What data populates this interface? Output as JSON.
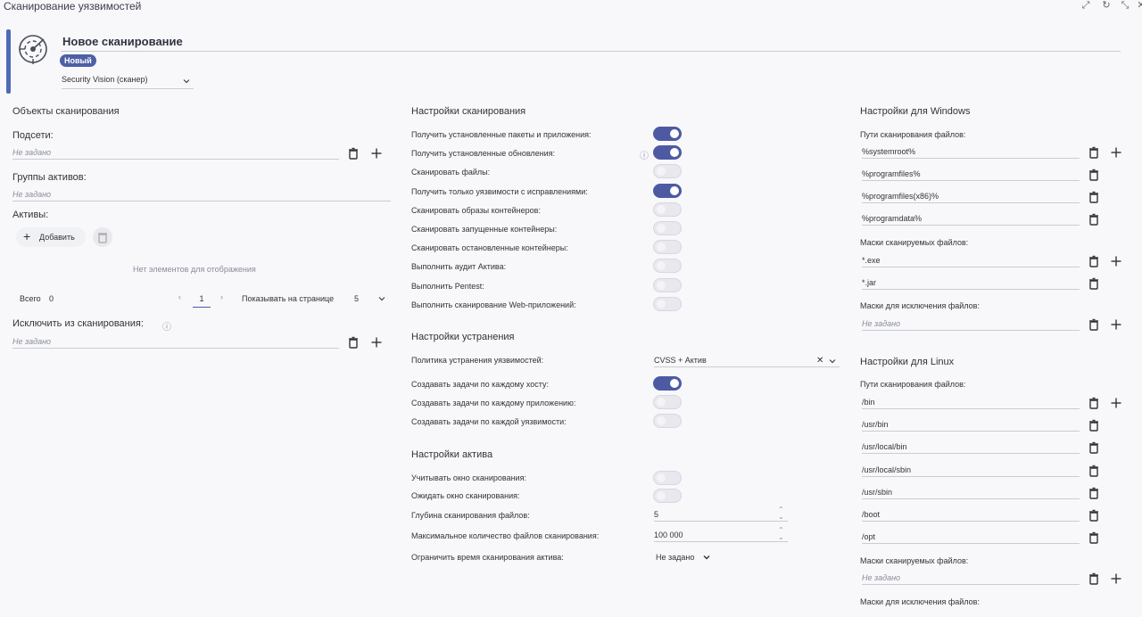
{
  "window": {
    "title": "Сканирование уязвимостей"
  },
  "header": {
    "title": "Новое сканирование",
    "badge": "Новый",
    "scanner": "Security Vision (сканер)"
  },
  "objects": {
    "title": "Объекты сканирования",
    "subnets_label": "Подсети:",
    "subnets_placeholder": "Не задано",
    "groups_label": "Группы активов:",
    "groups_placeholder": "Не задано",
    "assets_label": "Активы:",
    "add_label": "Добавить",
    "empty": "Нет элементов для отображения",
    "total_label": "Всего",
    "total_value": "0",
    "page": "1",
    "per_page_label": "Показывать на странице",
    "per_page_value": "5",
    "exclude_label": "Исключить из сканирования:",
    "exclude_placeholder": "Не задано"
  },
  "scan_settings": {
    "title": "Настройки сканирования",
    "items": [
      {
        "label": "Получить установленные пакеты и приложения:",
        "on": true
      },
      {
        "label": "Получить установленные обновления:",
        "on": true,
        "info": true
      },
      {
        "label": "Сканировать файлы:",
        "on": false
      },
      {
        "label": "Получить только уязвимости с исправлениями:",
        "on": true
      },
      {
        "label": "Сканировать образы контейнеров:",
        "on": false
      },
      {
        "label": "Сканировать запущенные контейнеры:",
        "on": false
      },
      {
        "label": "Сканировать остановленные контейнеры:",
        "on": false
      },
      {
        "label": "Выполнить аудит Актива:",
        "on": false
      },
      {
        "label": "Выполнить Pentest:",
        "on": false
      },
      {
        "label": "Выполнить сканирование Web-приложений:",
        "on": false
      }
    ]
  },
  "remediation": {
    "title": "Настройки устранения",
    "policy_label": "Политика устранения уязвимостей:",
    "policy_value": "CVSS + Актив",
    "items": [
      {
        "label": "Создавать задачи по каждому хосту:",
        "on": true
      },
      {
        "label": "Создавать задачи по каждому приложению:",
        "on": false
      },
      {
        "label": "Создавать задачи по каждой уязвимости:",
        "on": false
      }
    ]
  },
  "asset_settings": {
    "title": "Настройки актива",
    "window_label": "Учитывать окно сканирования:",
    "window_on": false,
    "wait_label": "Ожидать окно сканирования:",
    "wait_on": false,
    "depth_label": "Глубина сканирования файлов:",
    "depth_value": "5",
    "max_files_label": "Максимальное количество файлов сканирования:",
    "max_files_value": "100 000",
    "limit_label": "Ограничить время сканирования актива:",
    "limit_value": "Не задано"
  },
  "windows": {
    "title": "Настройки для Windows",
    "paths_label": "Пути сканирования файлов:",
    "paths": [
      "%systemroot%",
      "%programfiles%",
      "%programfiles(x86)%",
      "%programdata%"
    ],
    "masks_label": "Маски сканируемых файлов:",
    "masks": [
      "*.exe",
      "*.jar"
    ],
    "exclude_label": "Маски для исключения файлов:",
    "exclude_placeholder": "Не задано"
  },
  "linux": {
    "title": "Настройки для Linux",
    "paths_label": "Пути сканирования файлов:",
    "paths": [
      "/bin",
      "/usr/bin",
      "/usr/local/bin",
      "/usr/local/sbin",
      "/usr/sbin",
      "/boot",
      "/opt"
    ],
    "masks_label": "Маски сканируемых файлов:",
    "masks_placeholder": "Не задано",
    "exclude_label": "Маски для исключения файлов:"
  },
  "colors": {
    "accent": "#4d5aa3",
    "bar": "#4f6bb4"
  }
}
